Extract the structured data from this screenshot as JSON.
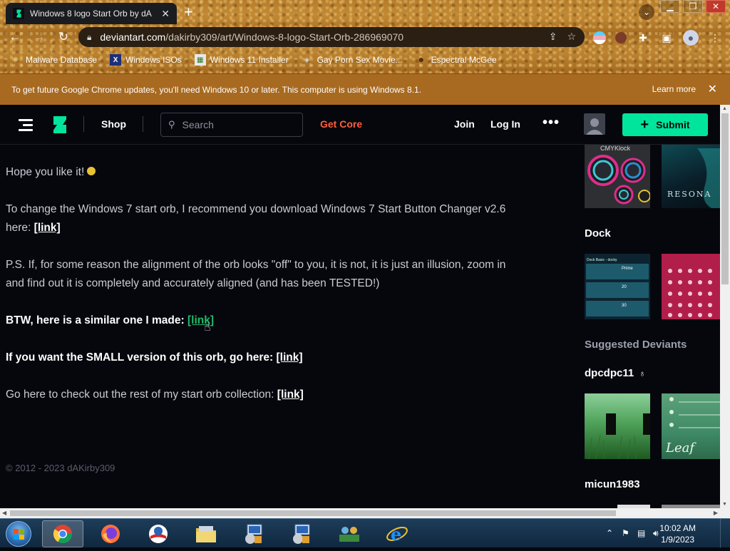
{
  "browser": {
    "tab_title": "Windows 8 logo Start Orb by dA",
    "tab_close": "✕",
    "new_tab": "+",
    "url_host": "deviantart.com",
    "url_path": "/dakirby309/art/Windows-8-logo-Start-Orb-286969070",
    "bookmarks": [
      {
        "label": "Malware Database",
        "icon": "globe-icon"
      },
      {
        "label": "Windows ISOs",
        "icon": "x-logo-icon"
      },
      {
        "label": "Windows 11 Installer",
        "icon": "installer-icon"
      },
      {
        "label": "Gay Porn Sex Movie...",
        "icon": "site-icon"
      },
      {
        "label": "Espectral McGee",
        "icon": "person-icon"
      }
    ]
  },
  "infobar": {
    "message": "To get future Google Chrome updates, you'll need Windows 10 or later. This computer is using Windows 8.1.",
    "learn_more": "Learn more",
    "close": "✕"
  },
  "header": {
    "shop": "Shop",
    "search_placeholder": "Search",
    "get_core": "Get Core",
    "join": "Join",
    "login": "Log In",
    "more": "•••",
    "submit": "Submit",
    "accent": "#00e59b",
    "core_color": "#ff5f3a"
  },
  "content": {
    "p1": "Hope you like it!",
    "p2_line1": "To change the Windows 7 start orb, I recommend you download Windows 7 Start Button Changer v2.6",
    "p2_line2": "here:",
    "link": "[link]",
    "p3_line1": "P.S. If, for some reason the alignment of the orb looks \"off\" to you, it is not, it is just an illusion, zoom in",
    "p3_line2": "and find out it is completely and accurately aligned (and has been TESTED!)",
    "p4": "BTW, here is a similar one I made:",
    "p5": "If you want the SMALL version of this orb, go here:",
    "p6": "Go here to check out the rest of my start orb collection:",
    "copyright": "© 2012 - 2023 dAKirby309"
  },
  "sidebar": {
    "section_dock": "Dock",
    "suggested": "Suggested Deviants",
    "deviant1": "dpcdpc11",
    "deviant2": "micun1983",
    "thumb_text_cmy": "CMYKlock",
    "thumb_text_reso": "RESONA",
    "thumb_text_dock_title": "Dock Basic - docky",
    "thumb_text_dock_nums": [
      "Prime",
      "20",
      "30"
    ],
    "thumb_text_leaf": "Leaf"
  },
  "taskbar": {
    "time": "10:02 AM",
    "date": "1/9/2023"
  }
}
